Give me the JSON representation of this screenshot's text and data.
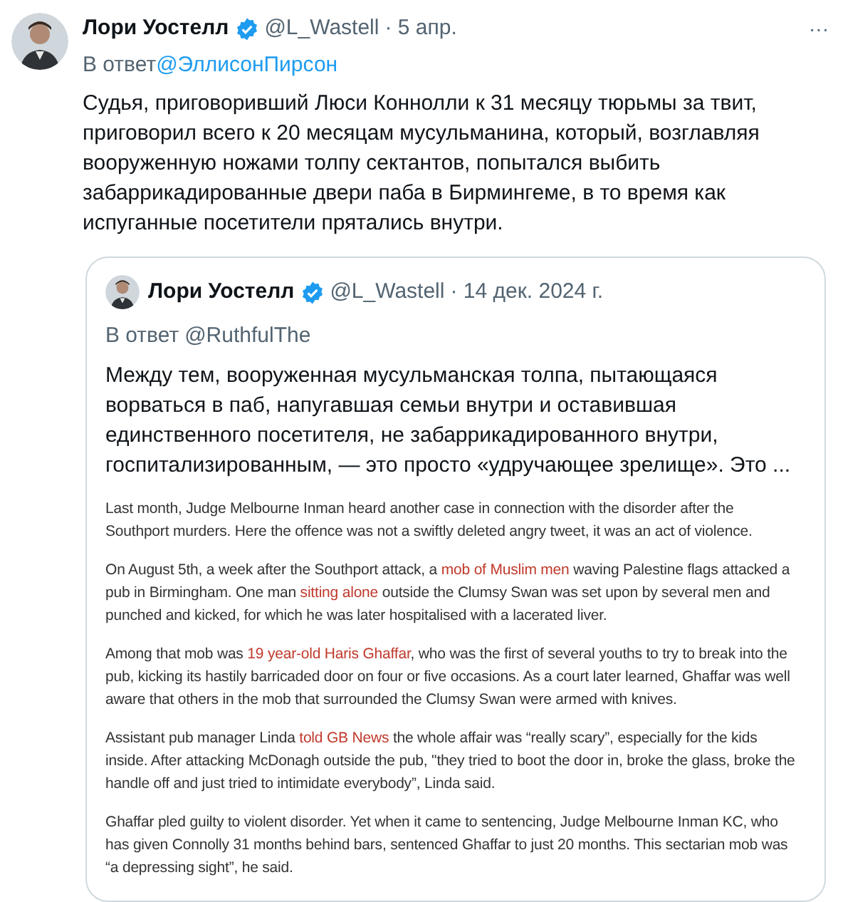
{
  "tweet": {
    "author": "Лори Уостелл",
    "handle": "@L_Wastell",
    "date": "· 5 апр.",
    "verified": true,
    "reply_prefix": "В ответ",
    "reply_to": "@ЭллисонПирсон",
    "more": "···",
    "text": "Судья, приговоривший Люси Коннолли к 31 месяцу тюрьмы за твит, приговорил всего к 20 месяцам мусульманина, который, возглавляя вооруженную ножами толпу сектантов, попытался выбить забаррикадированные двери паба в Бирмингеме, в то время как испуганные посетители прятались внутри."
  },
  "quote": {
    "author": "Лори Уостелл",
    "handle": "@L_Wastell",
    "date": "· 14 дек. 2024 г.",
    "verified": true,
    "reply_prefix": "В ответ",
    "reply_to": "@RuthfulThe",
    "text": "Между тем, вооруженная мусульманская толпа, пытающаяся ворваться в паб, напугавшая семьи внутри и оставившая единственного посетителя, не забаррикадированного внутри, госпитализированным, — это просто «удручающее зрелище». Это ...",
    "article": [
      [
        {
          "text": "Last month, Judge Melbourne Inman heard another case in connection with the disorder after the Southport murders. Here the offence was not a swiftly deleted angry tweet, it was an act of violence.",
          "link": false
        }
      ],
      [
        {
          "text": "On August 5th, a week after the Southport attack, a ",
          "link": false
        },
        {
          "text": "mob of Muslim men",
          "link": true
        },
        {
          "text": " waving Palestine flags attacked a pub in Birmingham. One man ",
          "link": false
        },
        {
          "text": "sitting alone",
          "link": true
        },
        {
          "text": " outside the Clumsy Swan was set upon by several men and punched and kicked, for which he was later hospitalised with a lacerated liver.",
          "link": false
        }
      ],
      [
        {
          "text": "Among that mob was ",
          "link": false
        },
        {
          "text": "19 year-old Haris Ghaffar",
          "link": true
        },
        {
          "text": ", who was the first of several youths to try to break into the pub, kicking its hastily barricaded door on four or five occasions. As a court later learned, Ghaffar was well aware that others in the mob that surrounded the Clumsy Swan were armed with knives.",
          "link": false
        }
      ],
      [
        {
          "text": "Assistant pub manager Linda ",
          "link": false
        },
        {
          "text": "told GB News",
          "link": true
        },
        {
          "text": " the whole affair was “really scary”, especially for the kids inside. After attacking McDonagh outside the pub, \"they tried to boot the door in, broke the glass, broke the handle off and just tried to intimidate everybody”, Linda said.",
          "link": false
        }
      ],
      [
        {
          "text": "Ghaffar pled guilty to violent disorder. Yet when it came to sentencing, Judge Melbourne Inman KC, who has given Connolly 31 months behind bars, sentenced Ghaffar to just 20 months. This sectarian mob was “a depressing sight”, he said.",
          "link": false
        }
      ]
    ]
  }
}
